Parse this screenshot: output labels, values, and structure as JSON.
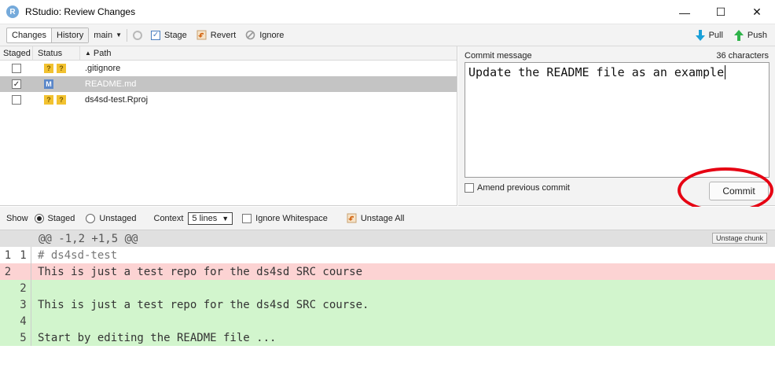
{
  "window": {
    "title": "RStudio: Review Changes",
    "logo_letter": "R",
    "controls": {
      "minimize": "—",
      "maximize": "☐",
      "close": "✕"
    }
  },
  "toolbar": {
    "tabs": [
      "Changes",
      "History"
    ],
    "branch": "main",
    "stage_label": "Stage",
    "revert_label": "Revert",
    "ignore_label": "Ignore",
    "pull_label": "Pull",
    "push_label": "Push"
  },
  "files": {
    "headers": {
      "staged": "Staged",
      "status": "Status",
      "path": "Path"
    },
    "rows": [
      {
        "staged": false,
        "status": [
          "?",
          "?"
        ],
        "path": ".gitignore",
        "selected": false
      },
      {
        "staged": true,
        "status": [
          "M"
        ],
        "path": "README.md",
        "selected": true
      },
      {
        "staged": false,
        "status": [
          "?",
          "?"
        ],
        "path": "ds4sd-test.Rproj",
        "selected": false
      }
    ]
  },
  "commit": {
    "label": "Commit message",
    "char_count": "36 characters",
    "message": "Update the README file as an example",
    "amend_label": "Amend previous commit",
    "commit_button": "Commit"
  },
  "diff_toolbar": {
    "show_label": "Show",
    "staged_label": "Staged",
    "unstaged_label": "Unstaged",
    "context_label": "Context",
    "context_value": "5 lines",
    "ignore_ws_label": "Ignore Whitespace",
    "unstage_all_label": "Unstage All"
  },
  "diff": {
    "hunk_header": "@@ -1,2 +1,5 @@",
    "unstage_chunk": "Unstage chunk",
    "lines": [
      {
        "type": "ctx",
        "old": "1",
        "new": "1",
        "text": "# ds4sd-test"
      },
      {
        "type": "del",
        "old": "2",
        "new": "",
        "text": "This is just a test repo for the ds4sd SRC course"
      },
      {
        "type": "add",
        "old": "",
        "new": "2",
        "text": ""
      },
      {
        "type": "add",
        "old": "",
        "new": "3",
        "text": "This is just a test repo for the ds4sd SRC course."
      },
      {
        "type": "add",
        "old": "",
        "new": "4",
        "text": ""
      },
      {
        "type": "add",
        "old": "",
        "new": "5",
        "text": "Start by editing the README file ..."
      }
    ]
  },
  "colors": {
    "added": "#d2f5cd",
    "deleted": "#fcd3d3",
    "annotation": "#e60012"
  }
}
